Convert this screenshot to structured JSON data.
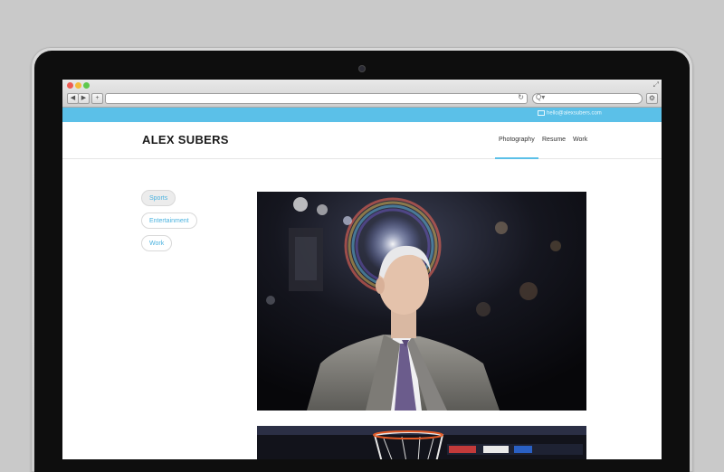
{
  "site": {
    "contact_email": "hello@alexsubers.com",
    "logo": "ALEX SUBERS",
    "nav": [
      "Photography",
      "Resume",
      "Work"
    ],
    "active_nav": "Photography",
    "categories": [
      "Sports",
      "Entertainment",
      "Work"
    ],
    "active_category": "Sports"
  },
  "browser": {
    "back_glyph": "◀",
    "forward_glyph": "▶",
    "new_tab_glyph": "+",
    "reload_glyph": "↻",
    "search_glyph": "Q▾",
    "expand_glyph": "⤢"
  },
  "colors": {
    "accent": "#5bc0e8",
    "link": "#4ab2df",
    "background": "#c9c9c9"
  }
}
